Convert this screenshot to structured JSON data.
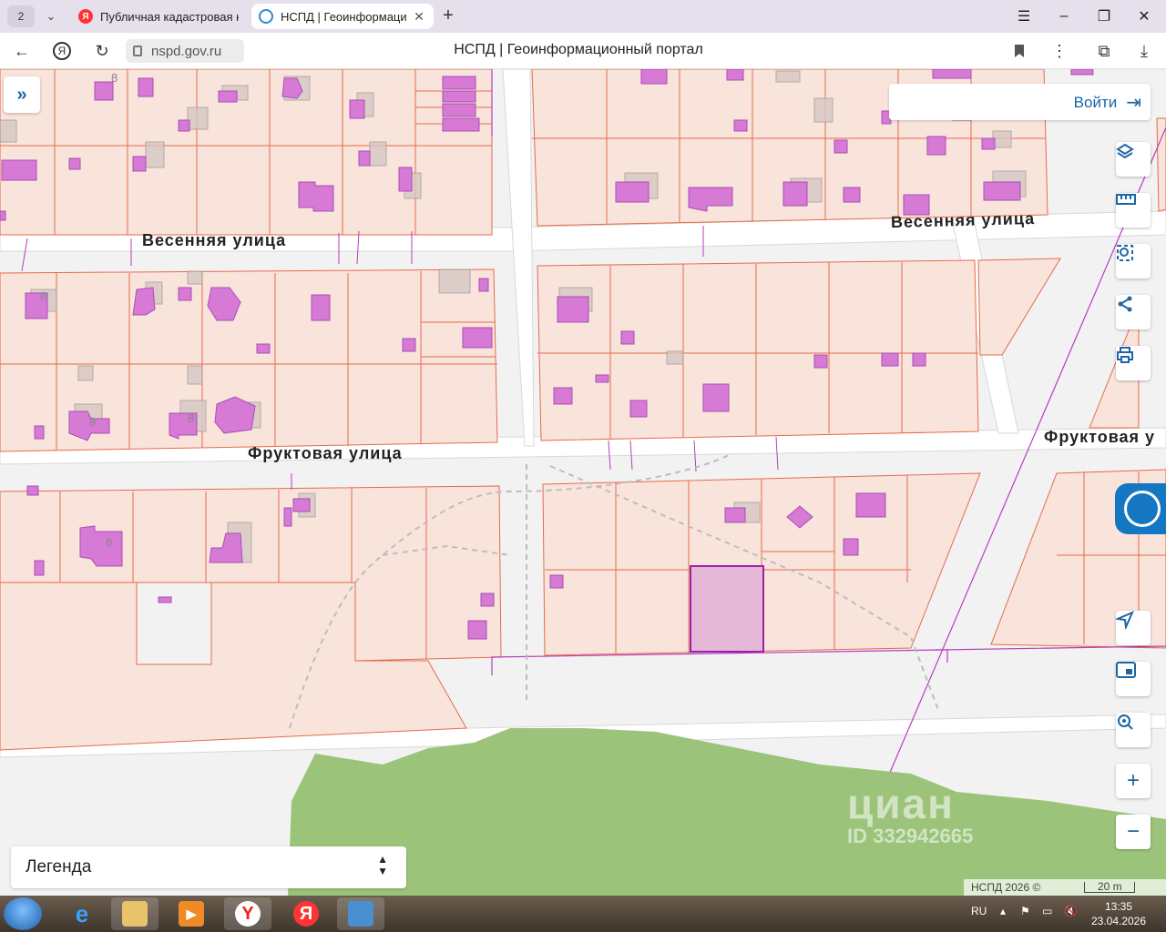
{
  "browser": {
    "tab_count": "2",
    "tabs": [
      {
        "title": "Публичная кадастровая к",
        "icon": "yandex-icon",
        "active": false
      },
      {
        "title": "НСПД | Геоинформаци",
        "icon": "nspd-icon",
        "active": true
      }
    ],
    "url": "nspd.gov.ru",
    "page_title": "НСПД | Геоинформационный портал"
  },
  "map": {
    "streets": {
      "vesennyaya_left": "Весенняя улица",
      "vesennyaya_right": "Весенняя улица",
      "fruktovaya_left": "Фруктовая улица",
      "fruktovaya_right": "Фруктовая у"
    },
    "building_floor_labels": [
      "8",
      "8",
      "8",
      "8",
      "8"
    ],
    "login_label": "Войти",
    "legend_label": "Легенда",
    "attribution": "НСПД 2026 ©",
    "scale_label": "20 m",
    "watermark": {
      "brand": "циан",
      "id": "ID 332942665"
    }
  },
  "toolbar": {
    "icons": [
      "layers-icon",
      "ruler-icon",
      "area-search-icon",
      "share-icon",
      "print-icon"
    ],
    "bottom_icons": [
      "navigate-icon",
      "minimap-icon",
      "location-search-icon"
    ],
    "zoom_in": "+",
    "zoom_out": "−"
  },
  "taskbar": {
    "lang": "RU",
    "time": "13:35",
    "date": "23.04.2026",
    "apps": [
      "explorer-ie-icon",
      "file-manager-icon",
      "media-player-icon",
      "yandex-browser-icon",
      "yandex-icon",
      "photo-viewer-icon"
    ]
  },
  "colors": {
    "parcel_fill": "#f9e4dc",
    "parcel_stroke": "#e56a4a",
    "building_fill": "#d67ad6",
    "selected_parcel_stroke": "#9b1fa8",
    "forest": "#9bc47a",
    "accent": "#1c66a5"
  }
}
